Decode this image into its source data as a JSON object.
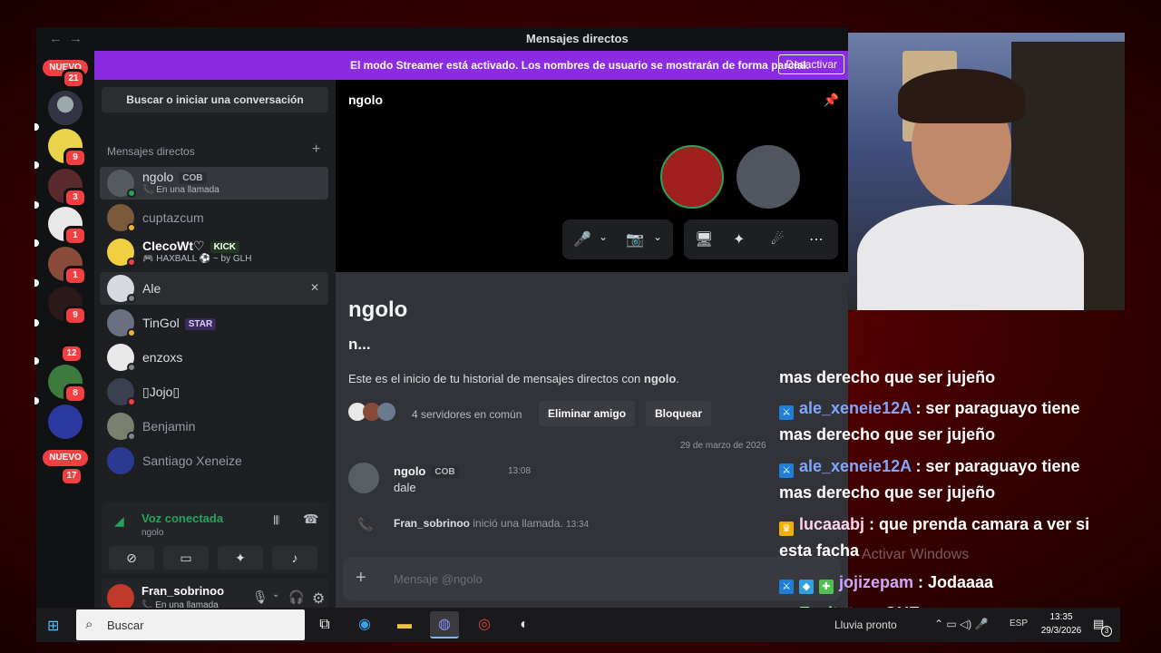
{
  "window": {
    "title": "Mensajes directos",
    "back": "←",
    "forward": "→"
  },
  "banner": {
    "text": "El modo Streamer está activado. Los nombres de usuario se mostrarán de forma parcial.",
    "button": "Desactivar"
  },
  "rail": {
    "nuevo_top": "NUEVO",
    "nuevo_bottom": "NUEVO",
    "badges": [
      "21",
      "9",
      "3",
      "1",
      "1",
      "9",
      "12",
      "8",
      "17"
    ]
  },
  "sidebar": {
    "search": "Buscar o iniciar una conversación",
    "dm_header": "Mensajes directos",
    "add": "+",
    "dms": [
      {
        "name": "ngolo",
        "tag": "COB",
        "sub": "📞 En una llamada"
      },
      {
        "name": "cuptazcum"
      },
      {
        "name": "CIecoWt♡",
        "tag": "KICK",
        "sub": "🎮 HAXBALL ⚽ ~ by GLH"
      },
      {
        "name": "Ale",
        "close": "✕"
      },
      {
        "name": "TinGol",
        "tag": "STAR"
      },
      {
        "name": "enzoxs"
      },
      {
        "name": "▯Jojo▯"
      },
      {
        "name": "Benjamin"
      },
      {
        "name": "Santiago Xeneize"
      }
    ]
  },
  "voice": {
    "status": "Voz conectada",
    "channel": "ngolo",
    "buttons": [
      "video-off",
      "screen-share",
      "activities",
      "soundboard"
    ]
  },
  "user": {
    "name": "Fran_sobrinoo",
    "status": "📞 En una llamada"
  },
  "call": {
    "header": "ngolo",
    "controls": [
      "🎤",
      "⌄",
      "📷",
      "⌄",
      "🖥",
      "✦",
      "☄",
      "⋯"
    ]
  },
  "intro": {
    "name": "ngolo",
    "user": "n...",
    "desc_prefix": "Este es el inicio de tu historial de mensajes directos con ",
    "desc_user": "ngolo",
    "desc_suffix": ".",
    "mutual": "4 servidores en común",
    "remove_friend": "Eliminar amigo",
    "block": "Bloquear"
  },
  "messages": {
    "date": "29 de marzo de 2026",
    "author": "ngolo",
    "author_tag": "COB",
    "time": "13:08",
    "text": "dale",
    "system_user": "Fran_sobrinoo",
    "system_text": " inició una llamada. ",
    "system_time": "13:34"
  },
  "composer": {
    "plus": "+",
    "placeholder": "Mensaje @ngolo"
  },
  "twitch_chat": [
    {
      "user": "",
      "text": "mas derecho que ser jujeño"
    },
    {
      "user": "ale_xeneie12A",
      "text": " : ser paraguayo tiene mas derecho que ser jujeño"
    },
    {
      "user": "ale_xeneie12A",
      "text": " : ser paraguayo tiene mas derecho que ser jujeño"
    },
    {
      "user": "lucaaabj",
      "text": " : que prenda camara a ver si esta facha"
    },
    {
      "user": "jojizepam",
      "text": " : Jodaaaa"
    },
    {
      "user": "Enzitotzz",
      "text": " : QUE"
    }
  ],
  "watermark": "Activar Windows",
  "taskbar": {
    "search": "Buscar",
    "weather": "Lluvia pronto",
    "lang": "ESP",
    "time": "13:35",
    "date": "29/3/2026",
    "notifications": "3"
  },
  "colors": {
    "accent": "#5865f2",
    "streamer_banner": "#8b2be2",
    "online": "#23a55a",
    "badge": "#f23f42"
  }
}
